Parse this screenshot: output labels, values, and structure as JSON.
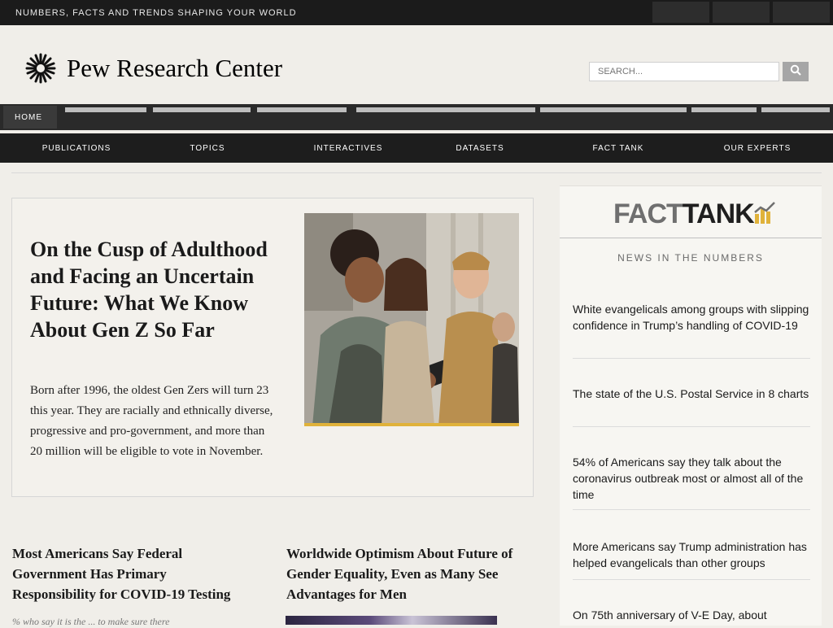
{
  "topbar": {
    "tagline": "NUMBERS, FACTS AND TRENDS SHAPING YOUR WORLD"
  },
  "header": {
    "logo_text": "Pew Research Center",
    "search_placeholder": "SEARCH..."
  },
  "nav": {
    "home": "HOME",
    "items": [
      "PUBLICATIONS",
      "TOPICS",
      "INTERACTIVES",
      "DATASETS",
      "FACT TANK",
      "OUR EXPERTS"
    ]
  },
  "featured": {
    "title": "On the Cusp of Adulthood and Facing an Uncertain Future: What We Know About Gen Z So Far",
    "summary": "Born after 1996, the oldest Gen Zers will turn 23 this year. They are racially and ethnically diverse, progressive and pro-government, and more than 20 million will be eligible to vote in November."
  },
  "sidebar": {
    "brand_left": "FACT",
    "brand_right": "TANK",
    "section_title": "NEWS IN THE NUMBERS",
    "items": [
      {
        "text": "White evangelicals among groups with slipping confidence in Trump’s handling of COVID-19"
      },
      {
        "text": "The state of the U.S. Postal Service in 8 charts"
      },
      {
        "text": "54% of Americans say they talk about the coronavirus outbreak most or almost all of the time"
      },
      {
        "text": "More Americans say Trump administration has helped evangelicals than other groups"
      },
      {
        "text": "On 75th anniversary of V-E Day, about"
      }
    ]
  },
  "stories": [
    {
      "title": "Most Americans Say Federal Government Has Primary Responsibility for COVID-19 Testing",
      "kicker": "% who say it is the ... to make sure there"
    },
    {
      "title": "Worldwide Optimism About Future of Gender Equality, Even as Many See Advantages for Men"
    }
  ],
  "colors": {
    "topbar": "#1b1b1b",
    "nav": "#1d1d1d",
    "accent_gold": "#e0b23a",
    "page_bg": "#f0eee9"
  }
}
